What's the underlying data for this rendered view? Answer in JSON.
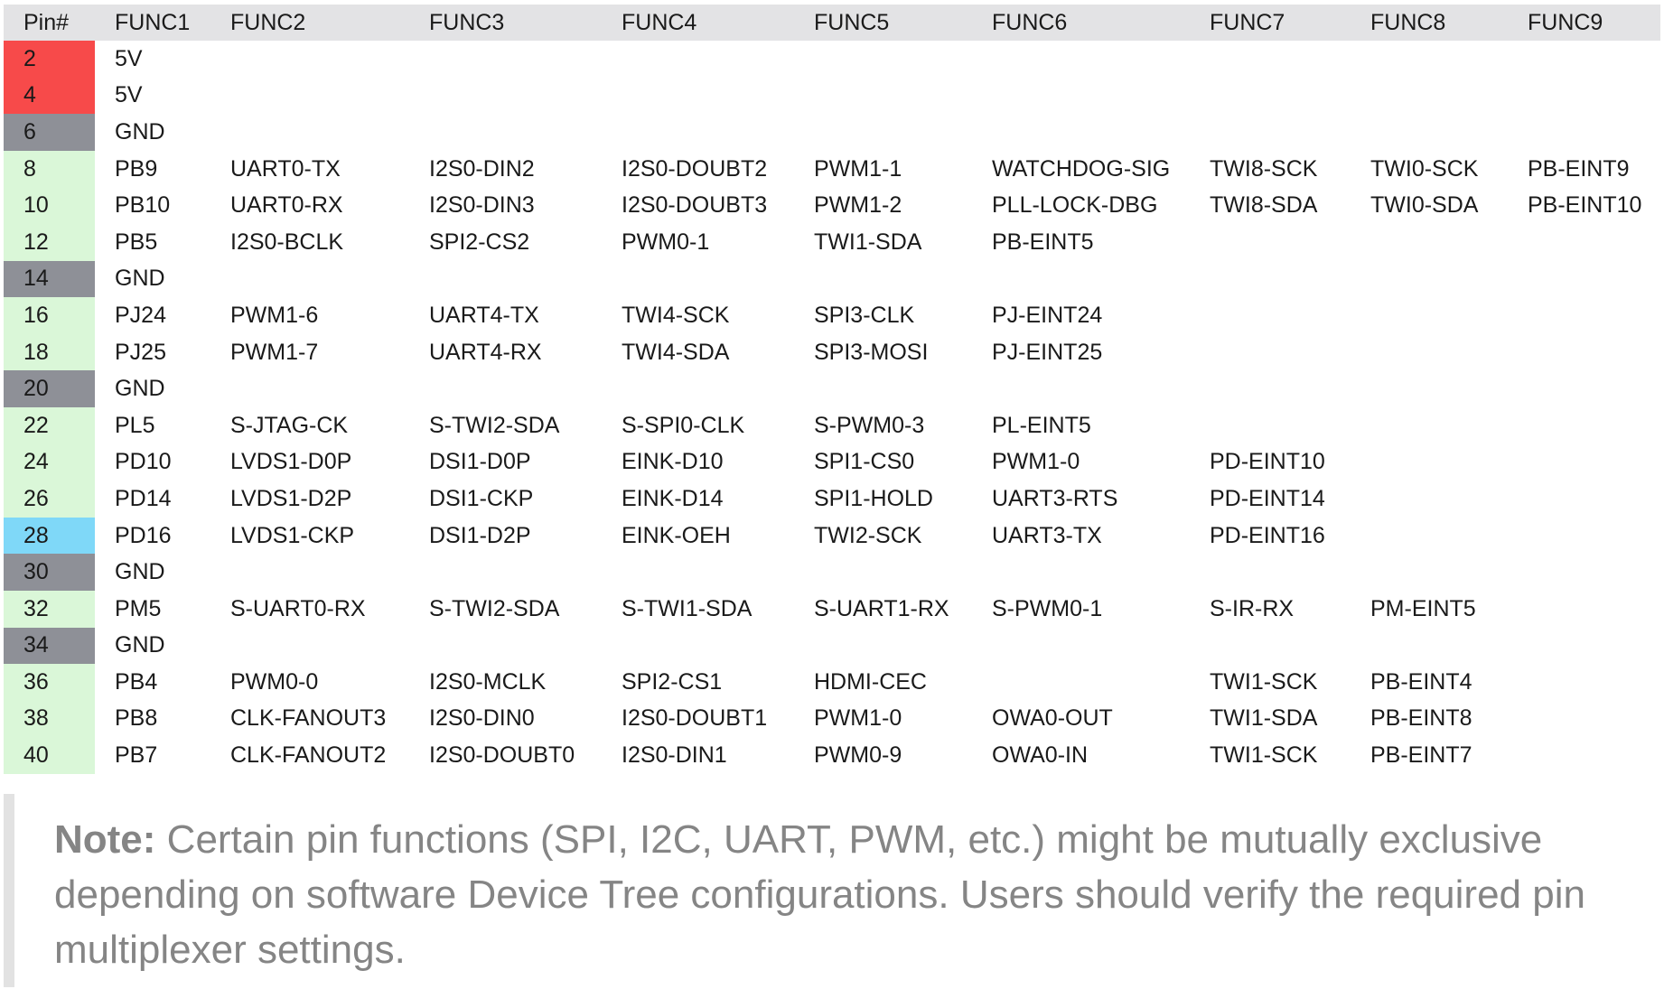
{
  "columns": [
    "Pin#",
    "FUNC1",
    "FUNC2",
    "FUNC3",
    "FUNC4",
    "FUNC5",
    "FUNC6",
    "FUNC7",
    "FUNC8",
    "FUNC9"
  ],
  "pin_colors": {
    "power": "#f74a4a",
    "ground": "#8e9097",
    "gpio": "#daf7d8",
    "special": "#7fd8f8"
  },
  "rows": [
    {
      "pin": "2",
      "kind": "power",
      "cells": [
        "5V",
        "",
        "",
        "",
        "",
        "",
        "",
        "",
        ""
      ]
    },
    {
      "pin": "4",
      "kind": "power",
      "cells": [
        "5V",
        "",
        "",
        "",
        "",
        "",
        "",
        "",
        ""
      ]
    },
    {
      "pin": "6",
      "kind": "ground",
      "cells": [
        "GND",
        "",
        "",
        "",
        "",
        "",
        "",
        "",
        ""
      ]
    },
    {
      "pin": "8",
      "kind": "gpio",
      "cells": [
        "PB9",
        "UART0-TX",
        "I2S0-DIN2",
        "I2S0-DOUBT2",
        "PWM1-1",
        "WATCHDOG-SIG",
        "TWI8-SCK",
        "TWI0-SCK",
        "PB-EINT9"
      ]
    },
    {
      "pin": "10",
      "kind": "gpio",
      "cells": [
        "PB10",
        "UART0-RX",
        "I2S0-DIN3",
        "I2S0-DOUBT3",
        "PWM1-2",
        "PLL-LOCK-DBG",
        "TWI8-SDA",
        "TWI0-SDA",
        "PB-EINT10"
      ]
    },
    {
      "pin": "12",
      "kind": "gpio",
      "cells": [
        "PB5",
        "I2S0-BCLK",
        "SPI2-CS2",
        "PWM0-1",
        "TWI1-SDA",
        "PB-EINT5",
        "",
        "",
        ""
      ]
    },
    {
      "pin": "14",
      "kind": "ground",
      "cells": [
        "GND",
        "",
        "",
        "",
        "",
        "",
        "",
        "",
        ""
      ]
    },
    {
      "pin": "16",
      "kind": "gpio",
      "cells": [
        "PJ24",
        "PWM1-6",
        "UART4-TX",
        "TWI4-SCK",
        "SPI3-CLK",
        "PJ-EINT24",
        "",
        "",
        ""
      ]
    },
    {
      "pin": "18",
      "kind": "gpio",
      "cells": [
        "PJ25",
        "PWM1-7",
        "UART4-RX",
        "TWI4-SDA",
        "SPI3-MOSI",
        "PJ-EINT25",
        "",
        "",
        ""
      ]
    },
    {
      "pin": "20",
      "kind": "ground",
      "cells": [
        "GND",
        "",
        "",
        "",
        "",
        "",
        "",
        "",
        ""
      ]
    },
    {
      "pin": "22",
      "kind": "gpio",
      "cells": [
        "PL5",
        "S-JTAG-CK",
        "S-TWI2-SDA",
        "S-SPI0-CLK",
        "S-PWM0-3",
        "PL-EINT5",
        "",
        "",
        ""
      ]
    },
    {
      "pin": "24",
      "kind": "gpio",
      "cells": [
        "PD10",
        "LVDS1-D0P",
        "DSI1-D0P",
        "EINK-D10",
        "SPI1-CS0",
        "PWM1-0",
        "PD-EINT10",
        "",
        ""
      ]
    },
    {
      "pin": "26",
      "kind": "gpio",
      "cells": [
        "PD14",
        "LVDS1-D2P",
        "DSI1-CKP",
        "EINK-D14",
        "SPI1-HOLD",
        "UART3-RTS",
        "PD-EINT14",
        "",
        ""
      ]
    },
    {
      "pin": "28",
      "kind": "special",
      "cells": [
        "PD16",
        "LVDS1-CKP",
        "DSI1-D2P",
        "EINK-OEH",
        "TWI2-SCK",
        "UART3-TX",
        "PD-EINT16",
        "",
        ""
      ]
    },
    {
      "pin": "30",
      "kind": "ground",
      "cells": [
        "GND",
        "",
        "",
        "",
        "",
        "",
        "",
        "",
        ""
      ]
    },
    {
      "pin": "32",
      "kind": "gpio",
      "cells": [
        "PM5",
        "S-UART0-RX",
        "S-TWI2-SDA",
        "S-TWI1-SDA",
        "S-UART1-RX",
        "S-PWM0-1",
        "S-IR-RX",
        "PM-EINT5",
        ""
      ]
    },
    {
      "pin": "34",
      "kind": "ground",
      "cells": [
        "GND",
        "",
        "",
        "",
        "",
        "",
        "",
        "",
        ""
      ]
    },
    {
      "pin": "36",
      "kind": "gpio",
      "cells": [
        "PB4",
        "PWM0-0",
        "I2S0-MCLK",
        "SPI2-CS1",
        "HDMI-CEC",
        "",
        "TWI1-SCK",
        "PB-EINT4",
        ""
      ]
    },
    {
      "pin": "38",
      "kind": "gpio",
      "cells": [
        "PB8",
        "CLK-FANOUT3",
        "I2S0-DIN0",
        "I2S0-DOUBT1",
        "PWM1-0",
        "OWA0-OUT",
        "TWI1-SDA",
        "PB-EINT8",
        ""
      ]
    },
    {
      "pin": "40",
      "kind": "gpio",
      "cells": [
        "PB7",
        "CLK-FANOUT2",
        "I2S0-DOUBT0",
        "I2S0-DIN1",
        "PWM0-9",
        "OWA0-IN",
        "TWI1-SCK",
        "PB-EINT7",
        ""
      ]
    }
  ],
  "note": {
    "label": "Note:",
    "text": " Certain pin functions (SPI, I2C, UART, PWM, etc.) might be mutually exclusive depending on software Device Tree configurations. Users should verify the required pin multiplexer settings."
  }
}
